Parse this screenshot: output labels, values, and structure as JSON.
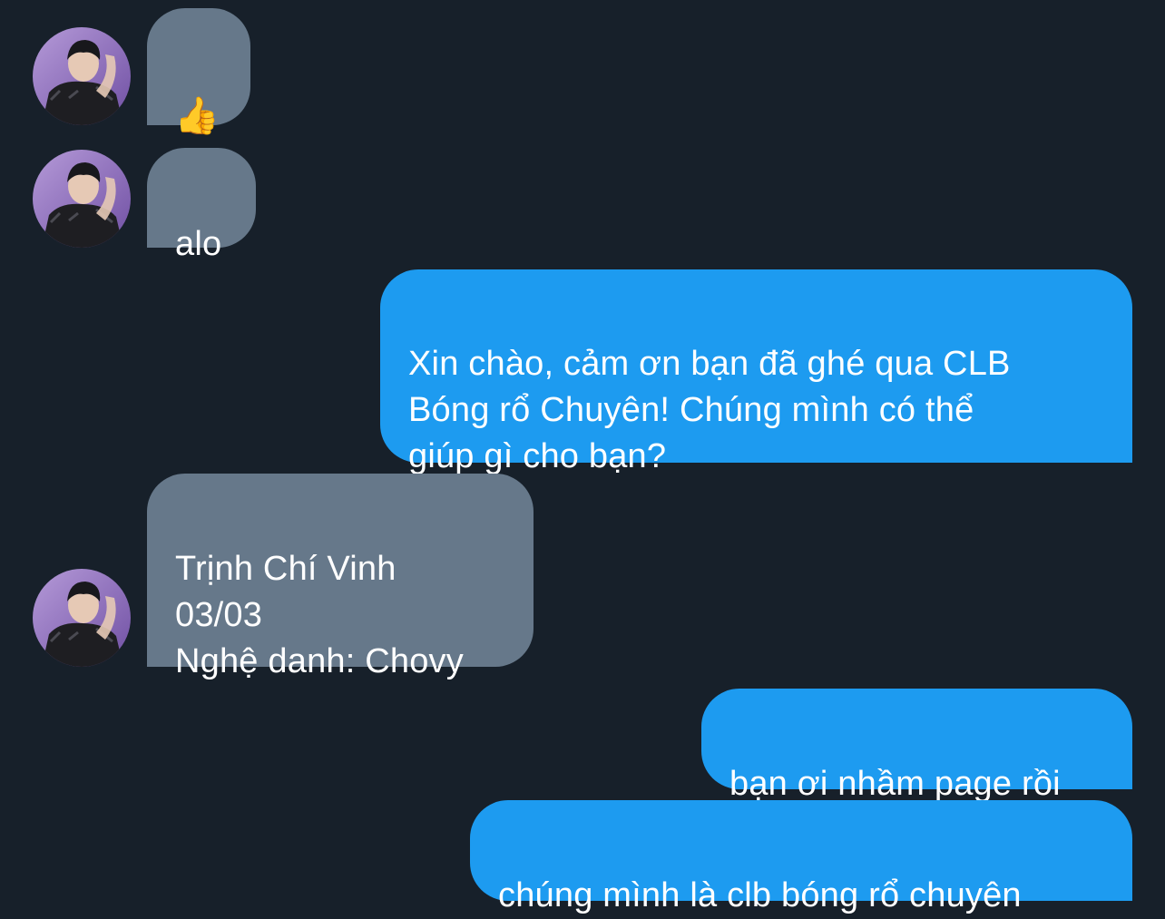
{
  "messages": [
    {
      "direction": "incoming",
      "text": "👍",
      "is_emoji": true
    },
    {
      "direction": "incoming",
      "text": "alo"
    },
    {
      "direction": "outgoing",
      "text": "Xin chào, cảm ơn bạn đã ghé qua CLB\nBóng rổ Chuyên! Chúng mình có thể\ngiúp gì cho bạn?"
    },
    {
      "direction": "incoming",
      "text": "Trịnh Chí Vinh\n03/03\nNghệ danh: Chovy"
    },
    {
      "direction": "outgoing",
      "text": "bạn ơi nhầm page rồi"
    },
    {
      "direction": "outgoing",
      "text": "chúng mình là clb bóng rổ chuyên"
    }
  ],
  "colors": {
    "background": "#17202a",
    "incoming_bubble": "#66788a",
    "outgoing_bubble": "#1d9bf0",
    "text": "#ffffff"
  },
  "icons": {
    "avatar": "sender-avatar-icon",
    "thumbs_up": "thumbs-up-emoji"
  }
}
